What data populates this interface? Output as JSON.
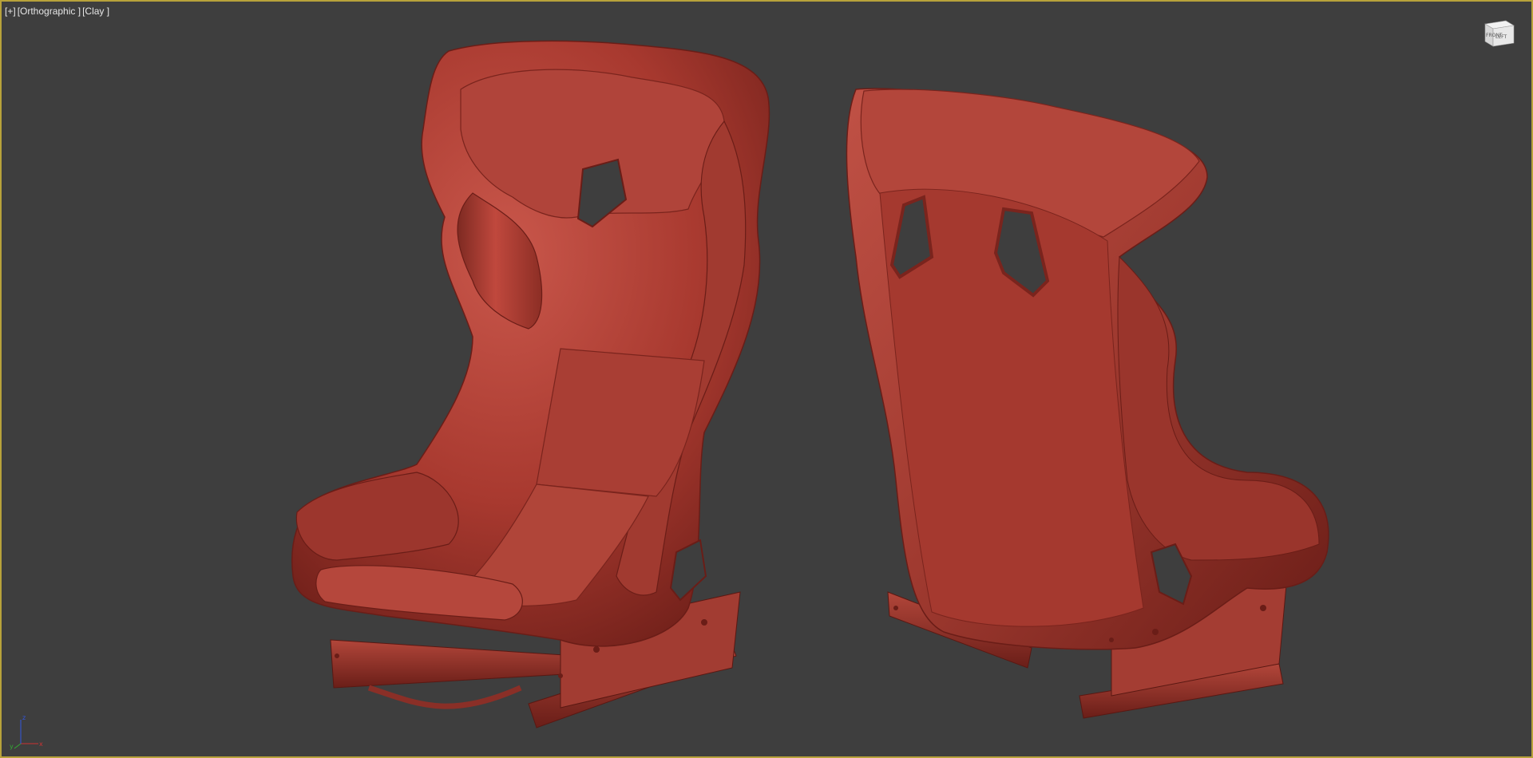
{
  "viewport": {
    "label_plus": "[+]",
    "label_view": "[Orthographic ]",
    "label_shading": "[Clay ]",
    "border_color": "#b8a23a",
    "background": "#3e3e3e"
  },
  "viewcube": {
    "face_left": "LEFT",
    "face_front": "FRONT"
  },
  "axis_gizmo": {
    "x": "x",
    "y": "y",
    "z": "z"
  },
  "scene": {
    "model_color": "#b0433a",
    "objects": [
      "racing-seat-front-view",
      "racing-seat-back-view"
    ]
  }
}
